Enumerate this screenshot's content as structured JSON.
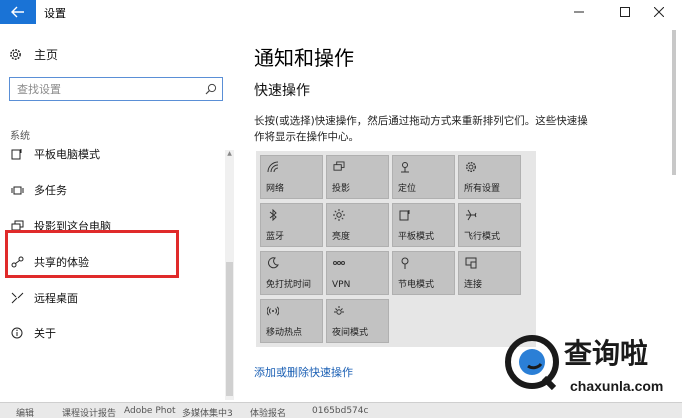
{
  "window": {
    "title": "设置",
    "back_icon": "arrow-left-icon",
    "controls": [
      "minimize-icon",
      "maximize-icon",
      "close-icon"
    ]
  },
  "sidebar": {
    "home_label": "主页",
    "search_placeholder": "查找设置",
    "section_label": "系统",
    "items": [
      {
        "label": "平板电脑模式",
        "icon": "tablet-mode-icon"
      },
      {
        "label": "多任务",
        "icon": "multitask-icon"
      },
      {
        "label": "投影到这台电脑",
        "icon": "project-icon"
      },
      {
        "label": "共享的体验",
        "icon": "shared-experience-icon"
      },
      {
        "label": "远程桌面",
        "icon": "remote-desktop-icon"
      },
      {
        "label": "关于",
        "icon": "info-icon"
      }
    ]
  },
  "main": {
    "title": "通知和操作",
    "section_title": "快速操作",
    "description": "长按(或选择)快速操作，然后通过拖动方式来重新排列它们。这些快速操作将显示在操作中心。",
    "tiles": [
      {
        "label": "网络",
        "icon": "network-icon"
      },
      {
        "label": "投影",
        "icon": "project-icon"
      },
      {
        "label": "定位",
        "icon": "location-icon"
      },
      {
        "label": "所有设置",
        "icon": "gear-icon"
      },
      {
        "label": "蓝牙",
        "icon": "bluetooth-icon"
      },
      {
        "label": "亮度",
        "icon": "brightness-icon"
      },
      {
        "label": "平板模式",
        "icon": "tablet-mode-icon"
      },
      {
        "label": "飞行模式",
        "icon": "airplane-icon"
      },
      {
        "label": "免打扰时间",
        "icon": "moon-icon"
      },
      {
        "label": "VPN",
        "icon": "vpn-icon"
      },
      {
        "label": "节电模式",
        "icon": "battery-saver-icon"
      },
      {
        "label": "连接",
        "icon": "connect-icon"
      },
      {
        "label": "移动热点",
        "icon": "hotspot-icon"
      },
      {
        "label": "夜间模式",
        "icon": "night-light-icon"
      }
    ],
    "link_label": "添加或删除快速操作"
  },
  "watermark": {
    "cn": "查询啦",
    "en": "chaxunla.com"
  },
  "taskbar": {
    "items": [
      "编辑",
      "课程设计报告",
      "Adobe Phot",
      "多媒体集中3",
      "体验报名",
      "0165bd574c"
    ]
  },
  "colors": {
    "accent": "#1a73d6",
    "highlight": "#e02a2a",
    "tile": "#c2c2c2",
    "link": "#1a5fb4"
  }
}
